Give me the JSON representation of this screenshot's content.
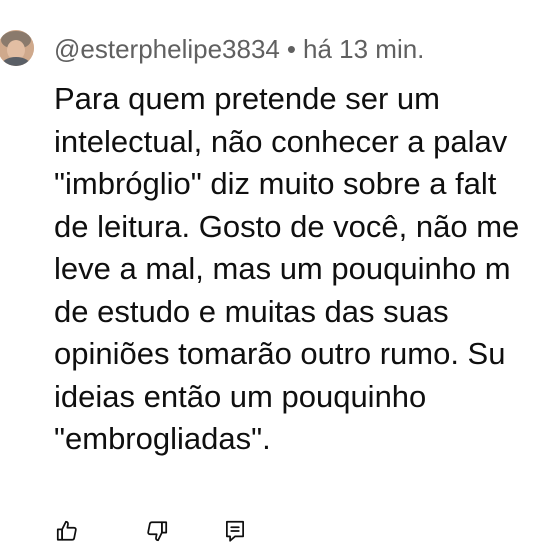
{
  "comment": {
    "author": "@esterphelipe3834",
    "separator": "•",
    "timestamp": "há 13 min.",
    "text_lines": [
      "Para quem pretende ser um",
      "intelectual, não conhecer a palav",
      "\"imbróglio\" diz muito sobre a falt",
      "de leitura. Gosto de você, não me",
      "leve a mal, mas um pouquinho m",
      "de estudo e muitas das suas",
      "opiniões tomarão outro rumo. Su",
      "ideias então um pouquinho",
      "\"embrogliadas\"."
    ]
  },
  "actions": {
    "like_icon": "thumbs-up-icon",
    "dislike_icon": "thumbs-down-icon",
    "reply_icon": "reply-comment-icon"
  },
  "colors": {
    "text": "#0f0f0f",
    "meta": "#606060",
    "icon": "#0f0f0f"
  }
}
